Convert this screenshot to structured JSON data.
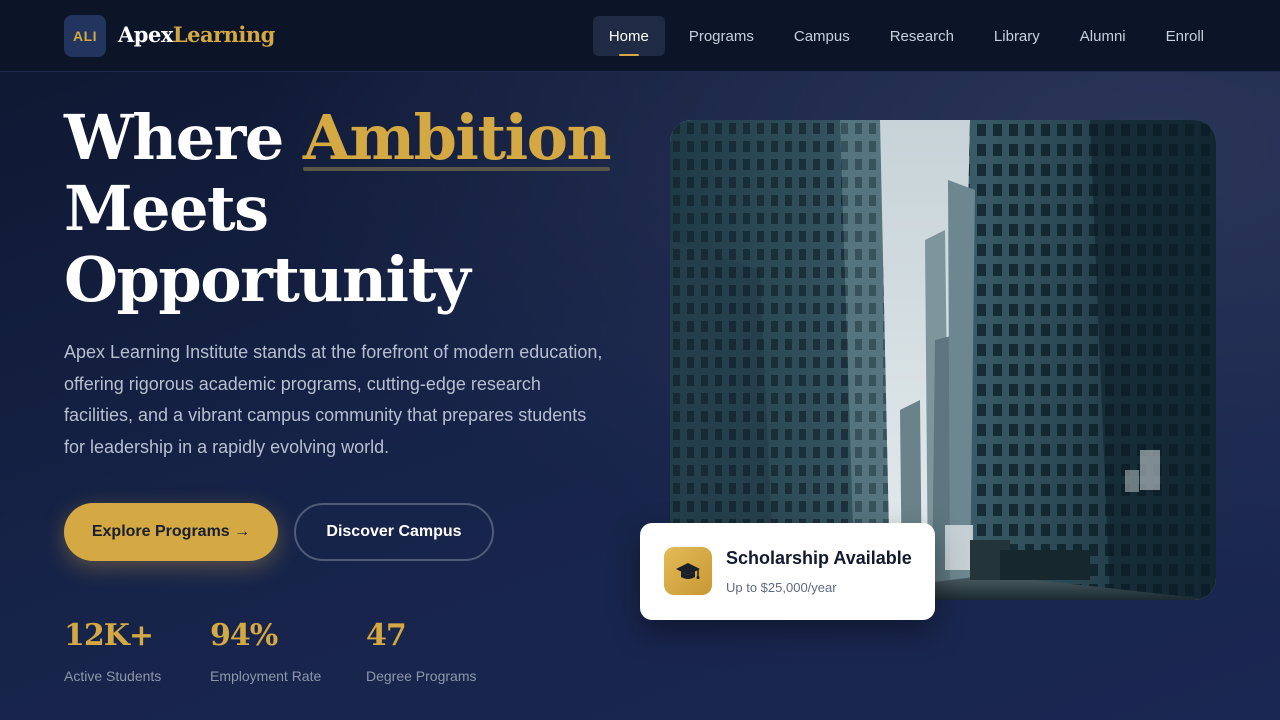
{
  "brand": {
    "badge": "ALI",
    "name_part1": "Apex",
    "name_part2": "Learning"
  },
  "nav": {
    "items": [
      {
        "label": "Home",
        "active": true
      },
      {
        "label": "Programs"
      },
      {
        "label": "Campus"
      },
      {
        "label": "Research"
      },
      {
        "label": "Library"
      },
      {
        "label": "Alumni"
      },
      {
        "label": "Enroll"
      }
    ]
  },
  "hero": {
    "headline_part1": "Where ",
    "headline_accent": "Ambition",
    "headline_line2": "Meets",
    "headline_line3": "Opportunity",
    "lead": "Apex Learning Institute stands at the forefront of modern education, offering rigorous academic programs, cutting-edge research facilities, and a vibrant campus community that prepares students for leadership in a rapidly evolving world.",
    "primary_button": "Explore Programs →",
    "secondary_button": "Discover Campus"
  },
  "stats": [
    {
      "value": "12K+",
      "label": "Active Students"
    },
    {
      "value": "94%",
      "label": "Employment Rate"
    },
    {
      "value": "47",
      "label": "Degree Programs"
    }
  ],
  "scholarship": {
    "icon": "graduation-cap-icon",
    "title": "Scholarship Available",
    "subtitle": "Up to $25,000/year"
  },
  "colors": {
    "accent": "#d4a843",
    "background": "#17244a",
    "nav_background": "#0c1428"
  }
}
